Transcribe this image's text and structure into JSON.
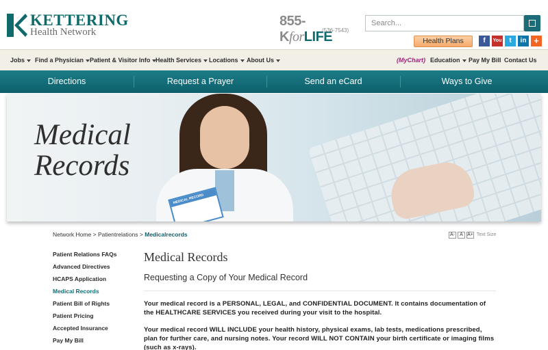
{
  "header": {
    "logo_line1": "KETTERING",
    "logo_line2": "Health Network",
    "phone_prefix": "855-",
    "phone_k": "K",
    "phone_for": "for",
    "phone_life": "LIFE",
    "phone_digits": "(536-7543)",
    "search_placeholder": "Search...",
    "health_plans_label": "Health Plans",
    "social": [
      "f",
      "You Tube",
      "t",
      "in",
      "+"
    ]
  },
  "topnav": {
    "items": [
      "Jobs",
      "Find a Physician",
      "Patient & Visitor Info",
      "Health Services",
      "Locations",
      "About Us"
    ],
    "right_items": [
      "(MyChart)",
      "Education",
      "Pay My Bill",
      "Contact Us"
    ]
  },
  "tealnav": {
    "links": [
      "Directions",
      "Request a Prayer",
      "Send an eCard",
      "Ways to Give"
    ]
  },
  "hero": {
    "title_line1": "Medical",
    "title_line2": "Records",
    "clipboard_text": "MEDICAL RECORD"
  },
  "breadcrumb": {
    "home": "Network Home",
    "sep": ">",
    "level2": "Patientrelations",
    "current": "Medicalrecords"
  },
  "textsize": {
    "minus": "A-",
    "normal": "A",
    "plus": "A+",
    "label": "Text Size"
  },
  "sidebar": {
    "items": [
      "Patient Relations FAQs",
      "Advanced Directives",
      "HCAPS Application",
      "Medical Records",
      "Patient Bill of Rights",
      "Patient Pricing",
      "Accepted Insurance",
      "Pay My Bill"
    ],
    "active_index": 3
  },
  "content": {
    "title": "Medical Records",
    "subtitle": "Requesting a Copy of Your Medical Record",
    "para1": "Your medical record is a PERSONAL, LEGAL, and CONFIDENTIAL DOCUMENT. It contains documentation of the HEALTHCARE SERVICES you received during your visit to the hospital.",
    "para2": "Your medical record WILL INCLUDE your health history, physical exams, lab tests, medications prescribed, plan for further care, and nursing notes. Your record WILL NOT CONTAIN your birth certificate or imaging films (such as x-rays)."
  },
  "colors": {
    "brand_teal": "#0d5f6b",
    "accent_orange": "#f6a96b",
    "mychart_magenta": "#a3237a"
  }
}
